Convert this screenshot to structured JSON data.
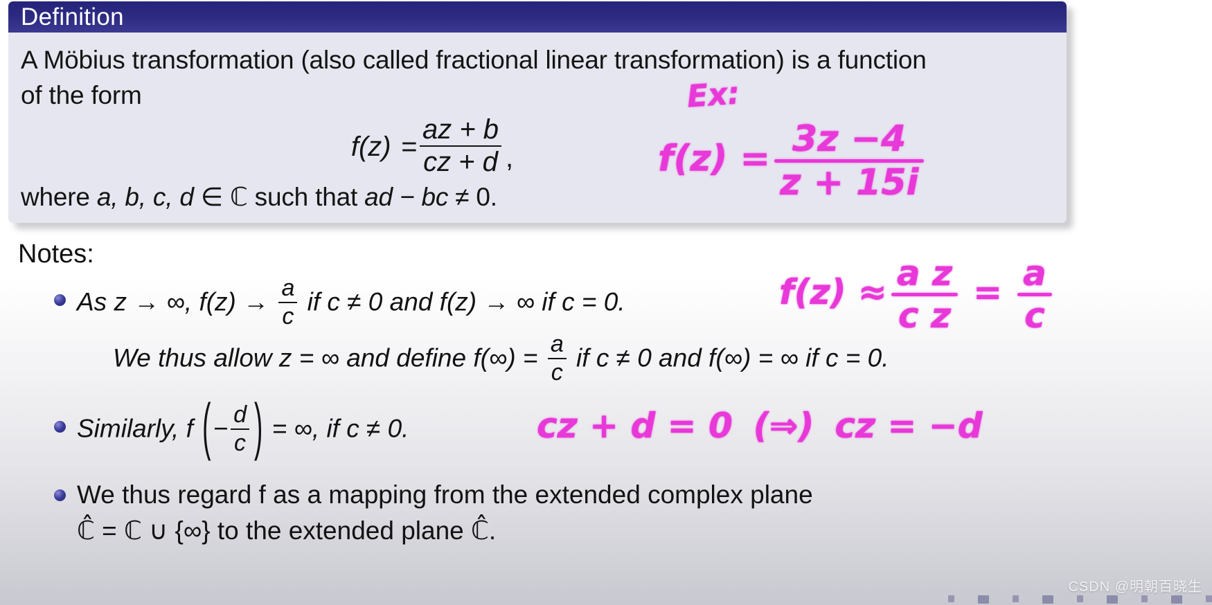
{
  "slide": {
    "definition": {
      "header_title": "Definition",
      "line1": "A Möbius transformation (also called fractional linear transformation) is a function",
      "line2": "of the form",
      "formula": {
        "lhs": "f(z)",
        "equals": "=",
        "numerator": "az + b",
        "denominator": "cz + d",
        "trailing_comma": ","
      },
      "line3_prefix": "where ",
      "line3_vars": "a, b, c, d",
      "line3_middle": " ∈ ℂ such that ",
      "line3_expr": "ad − bc",
      "line3_suffix": " ≠ 0."
    },
    "notes": {
      "title": "Notes:",
      "bullet1": {
        "part1": "As z → ∞, f(z) → ",
        "frac_num": "a",
        "frac_den": "c",
        "part2": " if c ≠ 0 and f(z) → ∞ if c = 0.",
        "subline_part1": "We thus allow z = ∞ and define f(∞) = ",
        "subline_frac_num": "a",
        "subline_frac_den": "c",
        "subline_part2": " if c ≠ 0 and f(∞) = ∞ if c = 0."
      },
      "bullet2": {
        "part1": "Similarly, f ",
        "paren_open": "(",
        "minus": "−",
        "frac_num": "d",
        "frac_den": "c",
        "paren_close": ")",
        "part2": " = ∞, if c ≠ 0."
      },
      "bullet3": {
        "line1": "We thus regard f as a mapping from the extended complex plane",
        "line2": "ℂ̂ = ℂ ∪ {∞} to the extended plane ℂ̂."
      }
    },
    "handwriting": {
      "ex_label": "Ex:",
      "example": {
        "lhs": "f(z) =",
        "numerator": "3z −4",
        "denominator": "z  + 15i"
      },
      "limit": {
        "lhs": "f(z) ≈",
        "numerator": "a z",
        "denominator": "c z",
        "equals": "=",
        "result_num": "a",
        "result_den": "c"
      },
      "pole": {
        "eq1": "cz + d = 0",
        "implies": "(⇒)",
        "eq2": "cz = −d"
      },
      "color": "#e838d8"
    },
    "watermark": "CSDN @明朝百晓生",
    "colors": {
      "header_blue": "#2c2a80",
      "definition_bg": "#e6e6f0",
      "bullet_navy": "#23236e",
      "handwriting_pink": "#e838d8"
    }
  }
}
